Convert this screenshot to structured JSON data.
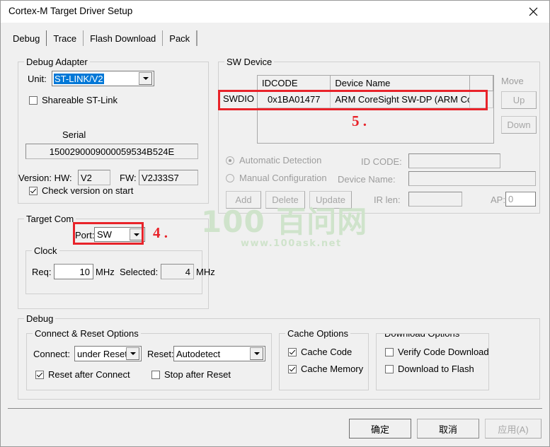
{
  "window": {
    "title": "Cortex-M Target Driver Setup",
    "close_icon": "close-icon"
  },
  "tabs": [
    {
      "label": "Debug",
      "active": true
    },
    {
      "label": "Trace",
      "active": false
    },
    {
      "label": "Flash Download",
      "active": false
    },
    {
      "label": "Pack",
      "active": false
    }
  ],
  "debug_adapter": {
    "group_label": "Debug Adapter",
    "unit_label": "Unit:",
    "unit_value": "ST-LINK/V2",
    "shareable_label": "Shareable ST-Link",
    "shareable_checked": false,
    "serial_label": "Serial",
    "serial_value": "1500290009000059534B524E",
    "version_label": "Version: HW:",
    "hw_value": "V2",
    "fw_label": "FW:",
    "fw_value": "V2J33S7",
    "check_version_label": "Check version on start",
    "check_version_checked": true
  },
  "target_com": {
    "group_label": "Target Com",
    "port_label": "Port:",
    "port_value": "SW",
    "clock_label": "Clock",
    "req_label": "Req:",
    "req_value": "10",
    "req_unit": "MHz",
    "selected_label": "Selected:",
    "selected_value": "4",
    "selected_unit": "MHz"
  },
  "sw_device": {
    "group_label": "SW Device",
    "columns": [
      "IDCODE",
      "Device Name"
    ],
    "row_header": "SWDIO",
    "rows": [
      {
        "idcode": "0x1BA01477",
        "device_name": "ARM CoreSight SW-DP (ARM Core"
      }
    ],
    "move_label": "Move",
    "up_label": "Up",
    "down_label": "Down",
    "automatic_detection_label": "Automatic Detection",
    "automatic_detection_selected": true,
    "manual_configuration_label": "Manual Configuration",
    "manual_configuration_selected": false,
    "id_code_label": "ID CODE:",
    "id_code_value": "",
    "device_name_label": "Device Name:",
    "device_name_value": "",
    "ir_len_label": "IR len:",
    "ir_len_value": "",
    "ap_label": "AP:",
    "ap_value": "0",
    "add_label": "Add",
    "delete_label": "Delete",
    "update_label": "Update"
  },
  "debug": {
    "group_label": "Debug",
    "connect_reset": {
      "group_label": "Connect & Reset Options",
      "connect_label": "Connect:",
      "connect_value": "under Reset",
      "reset_label": "Reset:",
      "reset_value": "Autodetect",
      "reset_after_connect_label": "Reset after Connect",
      "reset_after_connect_checked": true,
      "stop_after_reset_label": "Stop after Reset",
      "stop_after_reset_checked": false
    },
    "cache_options": {
      "group_label": "Cache Options",
      "cache_code_label": "Cache Code",
      "cache_code_checked": true,
      "cache_memory_label": "Cache Memory",
      "cache_memory_checked": true
    },
    "download_options": {
      "group_label": "Download Options",
      "verify_code_download_label": "Verify Code Download",
      "verify_code_download_checked": false,
      "download_to_flash_label": "Download to Flash",
      "download_to_flash_checked": false
    }
  },
  "footer": {
    "ok_label": "确定",
    "cancel_label": "取消",
    "apply_label": "应用(A)",
    "apply_disabled": true
  },
  "annotations": [
    {
      "id": "4",
      "text": "4 ."
    },
    {
      "id": "5",
      "text": "5 ."
    }
  ],
  "watermark": {
    "top": "100 百问网",
    "bottom": "www.100ask.net"
  },
  "colors": {
    "accent_selection": "#0078d7",
    "annotation_red": "#e8232a",
    "watermark_green": "#cfe3cb",
    "dialog_bg": "#f0f0f0"
  }
}
